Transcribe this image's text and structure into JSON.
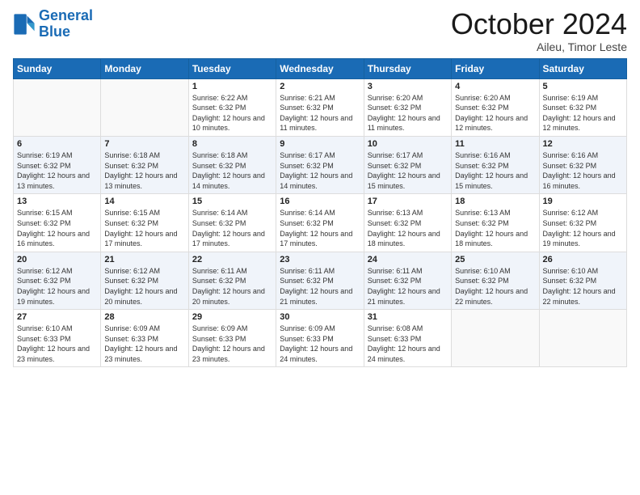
{
  "logo": {
    "line1": "General",
    "line2": "Blue"
  },
  "header": {
    "month": "October 2024",
    "location": "Aileu, Timor Leste"
  },
  "days_of_week": [
    "Sunday",
    "Monday",
    "Tuesday",
    "Wednesday",
    "Thursday",
    "Friday",
    "Saturday"
  ],
  "weeks": [
    [
      {
        "day": "",
        "sunrise": "",
        "sunset": "",
        "daylight": ""
      },
      {
        "day": "",
        "sunrise": "",
        "sunset": "",
        "daylight": ""
      },
      {
        "day": "1",
        "sunrise": "Sunrise: 6:22 AM",
        "sunset": "Sunset: 6:32 PM",
        "daylight": "Daylight: 12 hours and 10 minutes."
      },
      {
        "day": "2",
        "sunrise": "Sunrise: 6:21 AM",
        "sunset": "Sunset: 6:32 PM",
        "daylight": "Daylight: 12 hours and 11 minutes."
      },
      {
        "day": "3",
        "sunrise": "Sunrise: 6:20 AM",
        "sunset": "Sunset: 6:32 PM",
        "daylight": "Daylight: 12 hours and 11 minutes."
      },
      {
        "day": "4",
        "sunrise": "Sunrise: 6:20 AM",
        "sunset": "Sunset: 6:32 PM",
        "daylight": "Daylight: 12 hours and 12 minutes."
      },
      {
        "day": "5",
        "sunrise": "Sunrise: 6:19 AM",
        "sunset": "Sunset: 6:32 PM",
        "daylight": "Daylight: 12 hours and 12 minutes."
      }
    ],
    [
      {
        "day": "6",
        "sunrise": "Sunrise: 6:19 AM",
        "sunset": "Sunset: 6:32 PM",
        "daylight": "Daylight: 12 hours and 13 minutes."
      },
      {
        "day": "7",
        "sunrise": "Sunrise: 6:18 AM",
        "sunset": "Sunset: 6:32 PM",
        "daylight": "Daylight: 12 hours and 13 minutes."
      },
      {
        "day": "8",
        "sunrise": "Sunrise: 6:18 AM",
        "sunset": "Sunset: 6:32 PM",
        "daylight": "Daylight: 12 hours and 14 minutes."
      },
      {
        "day": "9",
        "sunrise": "Sunrise: 6:17 AM",
        "sunset": "Sunset: 6:32 PM",
        "daylight": "Daylight: 12 hours and 14 minutes."
      },
      {
        "day": "10",
        "sunrise": "Sunrise: 6:17 AM",
        "sunset": "Sunset: 6:32 PM",
        "daylight": "Daylight: 12 hours and 15 minutes."
      },
      {
        "day": "11",
        "sunrise": "Sunrise: 6:16 AM",
        "sunset": "Sunset: 6:32 PM",
        "daylight": "Daylight: 12 hours and 15 minutes."
      },
      {
        "day": "12",
        "sunrise": "Sunrise: 6:16 AM",
        "sunset": "Sunset: 6:32 PM",
        "daylight": "Daylight: 12 hours and 16 minutes."
      }
    ],
    [
      {
        "day": "13",
        "sunrise": "Sunrise: 6:15 AM",
        "sunset": "Sunset: 6:32 PM",
        "daylight": "Daylight: 12 hours and 16 minutes."
      },
      {
        "day": "14",
        "sunrise": "Sunrise: 6:15 AM",
        "sunset": "Sunset: 6:32 PM",
        "daylight": "Daylight: 12 hours and 17 minutes."
      },
      {
        "day": "15",
        "sunrise": "Sunrise: 6:14 AM",
        "sunset": "Sunset: 6:32 PM",
        "daylight": "Daylight: 12 hours and 17 minutes."
      },
      {
        "day": "16",
        "sunrise": "Sunrise: 6:14 AM",
        "sunset": "Sunset: 6:32 PM",
        "daylight": "Daylight: 12 hours and 17 minutes."
      },
      {
        "day": "17",
        "sunrise": "Sunrise: 6:13 AM",
        "sunset": "Sunset: 6:32 PM",
        "daylight": "Daylight: 12 hours and 18 minutes."
      },
      {
        "day": "18",
        "sunrise": "Sunrise: 6:13 AM",
        "sunset": "Sunset: 6:32 PM",
        "daylight": "Daylight: 12 hours and 18 minutes."
      },
      {
        "day": "19",
        "sunrise": "Sunrise: 6:12 AM",
        "sunset": "Sunset: 6:32 PM",
        "daylight": "Daylight: 12 hours and 19 minutes."
      }
    ],
    [
      {
        "day": "20",
        "sunrise": "Sunrise: 6:12 AM",
        "sunset": "Sunset: 6:32 PM",
        "daylight": "Daylight: 12 hours and 19 minutes."
      },
      {
        "day": "21",
        "sunrise": "Sunrise: 6:12 AM",
        "sunset": "Sunset: 6:32 PM",
        "daylight": "Daylight: 12 hours and 20 minutes."
      },
      {
        "day": "22",
        "sunrise": "Sunrise: 6:11 AM",
        "sunset": "Sunset: 6:32 PM",
        "daylight": "Daylight: 12 hours and 20 minutes."
      },
      {
        "day": "23",
        "sunrise": "Sunrise: 6:11 AM",
        "sunset": "Sunset: 6:32 PM",
        "daylight": "Daylight: 12 hours and 21 minutes."
      },
      {
        "day": "24",
        "sunrise": "Sunrise: 6:11 AM",
        "sunset": "Sunset: 6:32 PM",
        "daylight": "Daylight: 12 hours and 21 minutes."
      },
      {
        "day": "25",
        "sunrise": "Sunrise: 6:10 AM",
        "sunset": "Sunset: 6:32 PM",
        "daylight": "Daylight: 12 hours and 22 minutes."
      },
      {
        "day": "26",
        "sunrise": "Sunrise: 6:10 AM",
        "sunset": "Sunset: 6:32 PM",
        "daylight": "Daylight: 12 hours and 22 minutes."
      }
    ],
    [
      {
        "day": "27",
        "sunrise": "Sunrise: 6:10 AM",
        "sunset": "Sunset: 6:33 PM",
        "daylight": "Daylight: 12 hours and 23 minutes."
      },
      {
        "day": "28",
        "sunrise": "Sunrise: 6:09 AM",
        "sunset": "Sunset: 6:33 PM",
        "daylight": "Daylight: 12 hours and 23 minutes."
      },
      {
        "day": "29",
        "sunrise": "Sunrise: 6:09 AM",
        "sunset": "Sunset: 6:33 PM",
        "daylight": "Daylight: 12 hours and 23 minutes."
      },
      {
        "day": "30",
        "sunrise": "Sunrise: 6:09 AM",
        "sunset": "Sunset: 6:33 PM",
        "daylight": "Daylight: 12 hours and 24 minutes."
      },
      {
        "day": "31",
        "sunrise": "Sunrise: 6:08 AM",
        "sunset": "Sunset: 6:33 PM",
        "daylight": "Daylight: 12 hours and 24 minutes."
      },
      {
        "day": "",
        "sunrise": "",
        "sunset": "",
        "daylight": ""
      },
      {
        "day": "",
        "sunrise": "",
        "sunset": "",
        "daylight": ""
      }
    ]
  ]
}
